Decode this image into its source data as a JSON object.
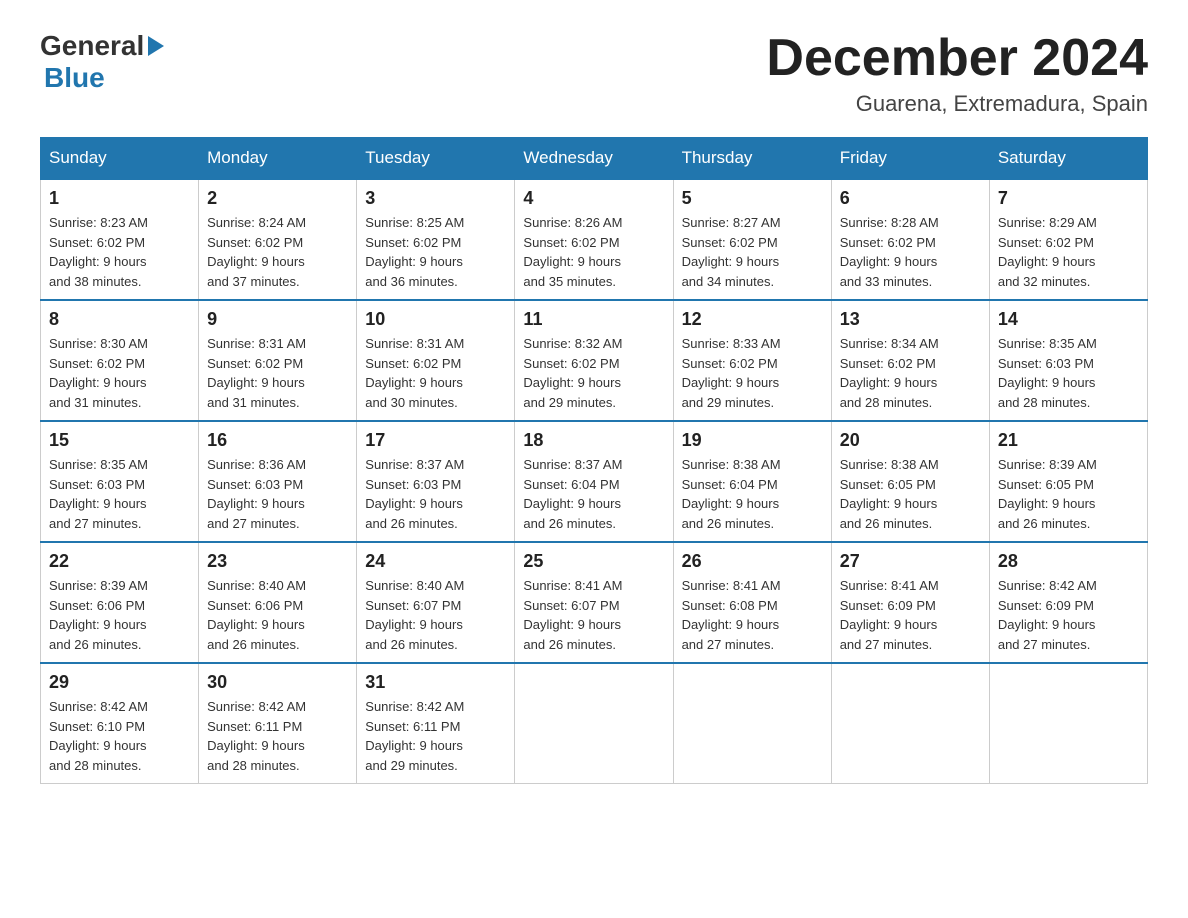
{
  "header": {
    "logo_general": "General",
    "logo_blue": "Blue",
    "month_title": "December 2024",
    "location": "Guarena, Extremadura, Spain"
  },
  "weekdays": [
    "Sunday",
    "Monday",
    "Tuesday",
    "Wednesday",
    "Thursday",
    "Friday",
    "Saturday"
  ],
  "weeks": [
    [
      {
        "day": "1",
        "sunrise": "8:23 AM",
        "sunset": "6:02 PM",
        "daylight": "9 hours and 38 minutes."
      },
      {
        "day": "2",
        "sunrise": "8:24 AM",
        "sunset": "6:02 PM",
        "daylight": "9 hours and 37 minutes."
      },
      {
        "day": "3",
        "sunrise": "8:25 AM",
        "sunset": "6:02 PM",
        "daylight": "9 hours and 36 minutes."
      },
      {
        "day": "4",
        "sunrise": "8:26 AM",
        "sunset": "6:02 PM",
        "daylight": "9 hours and 35 minutes."
      },
      {
        "day": "5",
        "sunrise": "8:27 AM",
        "sunset": "6:02 PM",
        "daylight": "9 hours and 34 minutes."
      },
      {
        "day": "6",
        "sunrise": "8:28 AM",
        "sunset": "6:02 PM",
        "daylight": "9 hours and 33 minutes."
      },
      {
        "day": "7",
        "sunrise": "8:29 AM",
        "sunset": "6:02 PM",
        "daylight": "9 hours and 32 minutes."
      }
    ],
    [
      {
        "day": "8",
        "sunrise": "8:30 AM",
        "sunset": "6:02 PM",
        "daylight": "9 hours and 31 minutes."
      },
      {
        "day": "9",
        "sunrise": "8:31 AM",
        "sunset": "6:02 PM",
        "daylight": "9 hours and 31 minutes."
      },
      {
        "day": "10",
        "sunrise": "8:31 AM",
        "sunset": "6:02 PM",
        "daylight": "9 hours and 30 minutes."
      },
      {
        "day": "11",
        "sunrise": "8:32 AM",
        "sunset": "6:02 PM",
        "daylight": "9 hours and 29 minutes."
      },
      {
        "day": "12",
        "sunrise": "8:33 AM",
        "sunset": "6:02 PM",
        "daylight": "9 hours and 29 minutes."
      },
      {
        "day": "13",
        "sunrise": "8:34 AM",
        "sunset": "6:02 PM",
        "daylight": "9 hours and 28 minutes."
      },
      {
        "day": "14",
        "sunrise": "8:35 AM",
        "sunset": "6:03 PM",
        "daylight": "9 hours and 28 minutes."
      }
    ],
    [
      {
        "day": "15",
        "sunrise": "8:35 AM",
        "sunset": "6:03 PM",
        "daylight": "9 hours and 27 minutes."
      },
      {
        "day": "16",
        "sunrise": "8:36 AM",
        "sunset": "6:03 PM",
        "daylight": "9 hours and 27 minutes."
      },
      {
        "day": "17",
        "sunrise": "8:37 AM",
        "sunset": "6:03 PM",
        "daylight": "9 hours and 26 minutes."
      },
      {
        "day": "18",
        "sunrise": "8:37 AM",
        "sunset": "6:04 PM",
        "daylight": "9 hours and 26 minutes."
      },
      {
        "day": "19",
        "sunrise": "8:38 AM",
        "sunset": "6:04 PM",
        "daylight": "9 hours and 26 minutes."
      },
      {
        "day": "20",
        "sunrise": "8:38 AM",
        "sunset": "6:05 PM",
        "daylight": "9 hours and 26 minutes."
      },
      {
        "day": "21",
        "sunrise": "8:39 AM",
        "sunset": "6:05 PM",
        "daylight": "9 hours and 26 minutes."
      }
    ],
    [
      {
        "day": "22",
        "sunrise": "8:39 AM",
        "sunset": "6:06 PM",
        "daylight": "9 hours and 26 minutes."
      },
      {
        "day": "23",
        "sunrise": "8:40 AM",
        "sunset": "6:06 PM",
        "daylight": "9 hours and 26 minutes."
      },
      {
        "day": "24",
        "sunrise": "8:40 AM",
        "sunset": "6:07 PM",
        "daylight": "9 hours and 26 minutes."
      },
      {
        "day": "25",
        "sunrise": "8:41 AM",
        "sunset": "6:07 PM",
        "daylight": "9 hours and 26 minutes."
      },
      {
        "day": "26",
        "sunrise": "8:41 AM",
        "sunset": "6:08 PM",
        "daylight": "9 hours and 27 minutes."
      },
      {
        "day": "27",
        "sunrise": "8:41 AM",
        "sunset": "6:09 PM",
        "daylight": "9 hours and 27 minutes."
      },
      {
        "day": "28",
        "sunrise": "8:42 AM",
        "sunset": "6:09 PM",
        "daylight": "9 hours and 27 minutes."
      }
    ],
    [
      {
        "day": "29",
        "sunrise": "8:42 AM",
        "sunset": "6:10 PM",
        "daylight": "9 hours and 28 minutes."
      },
      {
        "day": "30",
        "sunrise": "8:42 AM",
        "sunset": "6:11 PM",
        "daylight": "9 hours and 28 minutes."
      },
      {
        "day": "31",
        "sunrise": "8:42 AM",
        "sunset": "6:11 PM",
        "daylight": "9 hours and 29 minutes."
      },
      null,
      null,
      null,
      null
    ]
  ],
  "labels": {
    "sunrise": "Sunrise:",
    "sunset": "Sunset:",
    "daylight": "Daylight:"
  }
}
